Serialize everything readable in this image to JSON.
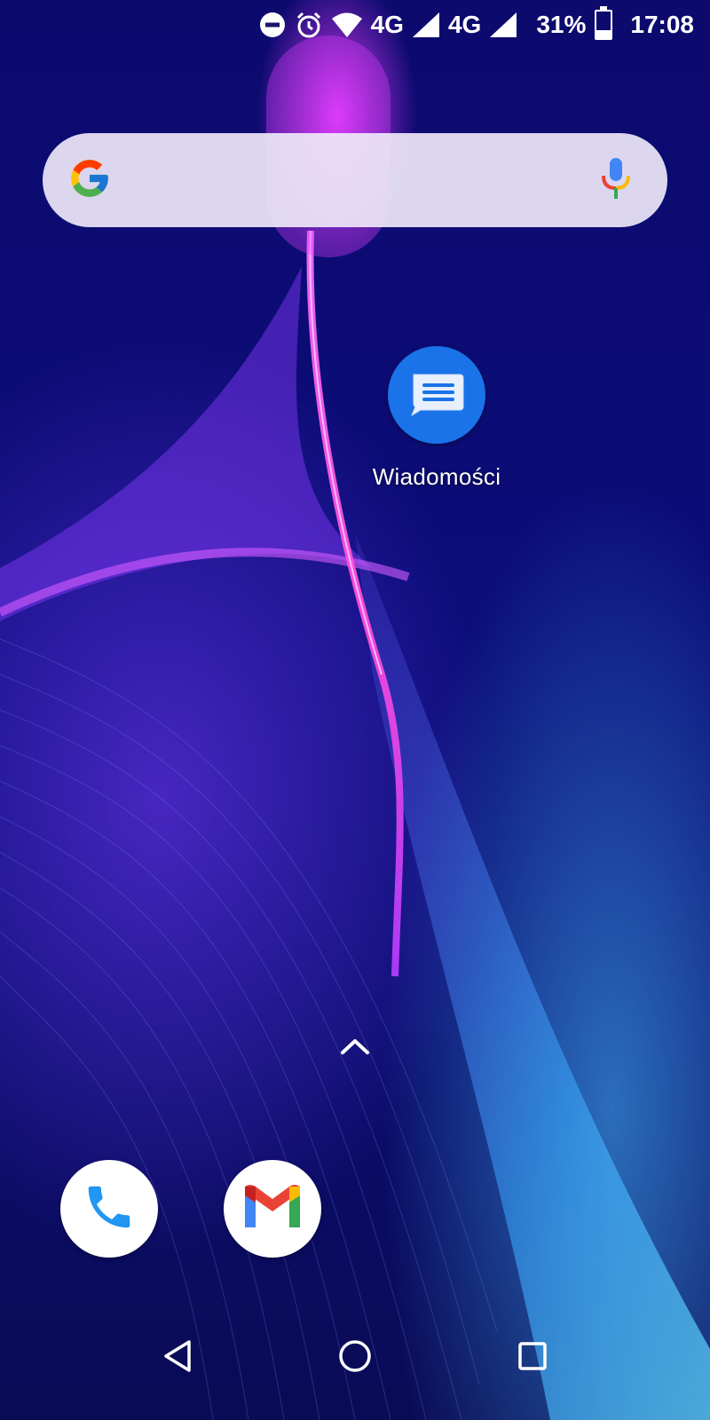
{
  "status_bar": {
    "network_1": "4G",
    "network_2": "4G",
    "battery_percent": "31%",
    "battery_level": 0.31,
    "time": "17:08",
    "icons": [
      "do-not-disturb-icon",
      "alarm-icon",
      "wifi-icon",
      "signal-icon",
      "signal-icon",
      "battery-icon"
    ]
  },
  "search_bar": {
    "icons": [
      "google-logo-icon",
      "microphone-icon"
    ]
  },
  "home_apps": [
    {
      "label": "Wiadomości",
      "icon": "messages-icon",
      "color": "#1a73e8"
    }
  ],
  "dock": [
    {
      "icon": "phone-icon",
      "color": "#2196f3"
    },
    {
      "icon": "gmail-icon"
    }
  ],
  "navigation": {
    "buttons": [
      "back-icon",
      "home-icon",
      "recents-icon"
    ]
  }
}
